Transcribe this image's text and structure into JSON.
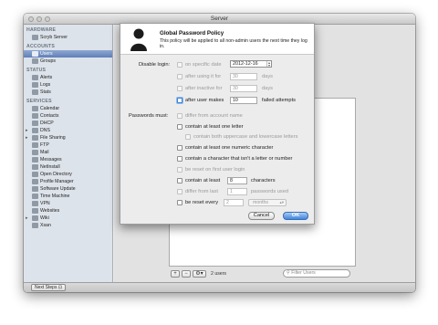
{
  "window": {
    "title": "Server"
  },
  "sidebar": {
    "sections": [
      {
        "heading": "HARDWARE",
        "items": [
          {
            "label": "Scryb Server",
            "icon": "server-icon"
          }
        ]
      },
      {
        "heading": "ACCOUNTS",
        "items": [
          {
            "label": "Users",
            "icon": "users-icon",
            "selected": true
          },
          {
            "label": "Groups",
            "icon": "groups-icon"
          }
        ]
      },
      {
        "heading": "STATUS",
        "items": [
          {
            "label": "Alerts",
            "icon": "alert-icon"
          },
          {
            "label": "Logs",
            "icon": "logs-icon"
          },
          {
            "label": "Stats",
            "icon": "stats-icon"
          }
        ]
      },
      {
        "heading": "SERVICES",
        "items": [
          {
            "label": "Calendar",
            "icon": "calendar-icon"
          },
          {
            "label": "Contacts",
            "icon": "contacts-icon"
          },
          {
            "label": "DHCP",
            "icon": "dhcp-icon"
          },
          {
            "label": "DNS",
            "icon": "dns-icon",
            "disclosure": true
          },
          {
            "label": "File Sharing",
            "icon": "file-sharing-icon",
            "disclosure": true
          },
          {
            "label": "FTP",
            "icon": "ftp-icon"
          },
          {
            "label": "Mail",
            "icon": "mail-icon"
          },
          {
            "label": "Messages",
            "icon": "messages-icon"
          },
          {
            "label": "NetInstall",
            "icon": "netinstall-icon"
          },
          {
            "label": "Open Directory",
            "icon": "open-directory-icon"
          },
          {
            "label": "Profile Manager",
            "icon": "profile-manager-icon"
          },
          {
            "label": "Software Update",
            "icon": "software-update-icon"
          },
          {
            "label": "Time Machine",
            "icon": "time-machine-icon"
          },
          {
            "label": "VPN",
            "icon": "vpn-icon"
          },
          {
            "label": "Websites",
            "icon": "websites-icon"
          },
          {
            "label": "Wiki",
            "icon": "wiki-icon",
            "disclosure": true
          },
          {
            "label": "Xsan",
            "icon": "xsan-icon"
          }
        ]
      }
    ]
  },
  "bottombar": {
    "next_steps": "Next Steps"
  },
  "userlist": {
    "count": "2 users",
    "filter_placeholder": "Filter Users",
    "add": "+",
    "remove": "−",
    "action": "⚙▾"
  },
  "sheet": {
    "title": "Global Password Policy",
    "description": "This policy will be applied to all non-admin users the next time they log in.",
    "disable_login_label": "Disable login:",
    "on_specific_date": "on specific date",
    "date_value": "2012-12-16",
    "after_using_for": "after using it for",
    "using_days_value": "30",
    "after_inactive_for": "after inactive for",
    "inactive_days_value": "30",
    "days": "days",
    "after_user_makes": "after user makes",
    "failed_attempts_value": "10",
    "failed_attempts": "failed attempts",
    "passwords_must_label": "Passwords must:",
    "differ_from_account_name": "differ from account name",
    "contain_letter": "contain at least one letter",
    "contain_upper_lower": "contain both uppercase and lowercase letters",
    "contain_numeric": "contain at least one numeric character",
    "contain_non_letter": "contain a character that isn't a letter or number",
    "reset_first_login": "be reset on first user login",
    "contain_at_least": "contain at least",
    "characters_value": "8",
    "characters": "characters",
    "differ_from_last": "differ from last",
    "passwords_used_value": "1",
    "passwords_used": "passwords used",
    "reset_every": "be reset every",
    "reset_every_value": "2",
    "months": "months",
    "cancel": "Cancel",
    "ok": "OK"
  }
}
